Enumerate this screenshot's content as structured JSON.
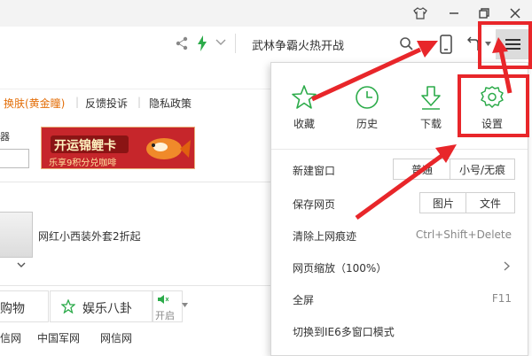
{
  "titlebar": {
    "skin_icon": "tshirt-icon",
    "min_icon": "minimize-icon",
    "restore_icon": "restore-icon",
    "close_icon": "close-icon"
  },
  "address_bar": {
    "search_text": "武林争霸火热开战",
    "icons": [
      "share-icon",
      "lightning-icon",
      "chevron-down-icon",
      "search-icon",
      "phone-icon",
      "undo-icon",
      "menu-icon"
    ]
  },
  "page": {
    "top_links": [
      "换肤(黄金瞳)",
      "反馈投诉",
      "隐私政策"
    ],
    "side_char": "器",
    "banner_line1": "开运锦鲤卡",
    "banner_line2": "乐享9积分兑咖啡",
    "promo_text": "网红小西装外套2折起",
    "tab1": "购物",
    "tab2": "娱乐八卦",
    "toggle_label": "开启",
    "bottom_links": [
      "信网",
      "中国军网",
      "网信网"
    ]
  },
  "menu": {
    "quick": [
      {
        "icon": "star-icon",
        "label": "收藏"
      },
      {
        "icon": "clock-icon",
        "label": "历史"
      },
      {
        "icon": "download-icon",
        "label": "下载"
      },
      {
        "icon": "gear-icon",
        "label": "设置"
      }
    ],
    "new_window": {
      "label": "新建窗口",
      "btn1": "普通",
      "btn2": "小号/无痕"
    },
    "save_page": {
      "label": "保存网页",
      "btn1": "图片",
      "btn2": "文件"
    },
    "clear_trace": {
      "label": "清除上网痕迹",
      "shortcut": "Ctrl+Shift+Delete"
    },
    "zoom": {
      "label": "网页缩放（100%）"
    },
    "fullscreen": {
      "label": "全屏",
      "shortcut": "F11"
    },
    "ie6": {
      "label": "切换到IE6多窗口模式"
    }
  },
  "colors": {
    "accent": "#2cab4a",
    "annotation": "#e8262a",
    "link_orange": "#e36f0a"
  }
}
